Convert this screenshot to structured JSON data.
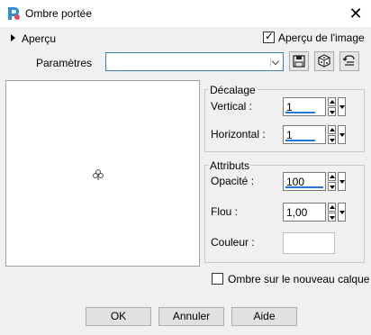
{
  "window": {
    "title": "Ombre portée"
  },
  "preview_toggle": {
    "label": "Aperçu"
  },
  "image_preview": {
    "label": "Aperçu de l'image",
    "checked": true
  },
  "params": {
    "label": "Paramètres",
    "value": ""
  },
  "groups": {
    "offset": {
      "title": "Décalage",
      "vertical": {
        "label": "Vertical :",
        "value": "1"
      },
      "horizontal": {
        "label": "Horizontal :",
        "value": "1"
      }
    },
    "attributes": {
      "title": "Attributs",
      "opacity": {
        "label": "Opacité :",
        "value": "100"
      },
      "blur": {
        "label": "Flou :",
        "value": "1,00"
      },
      "color": {
        "label": "Couleur :",
        "value": "#ffffff"
      }
    }
  },
  "new_layer": {
    "label": "Ombre sur le nouveau calque",
    "checked": false
  },
  "buttons": {
    "ok": "OK",
    "cancel": "Annuler",
    "help": "Aide"
  },
  "colors": {
    "accent": "#1e78d7",
    "window_bg": "#f0f0f0"
  }
}
